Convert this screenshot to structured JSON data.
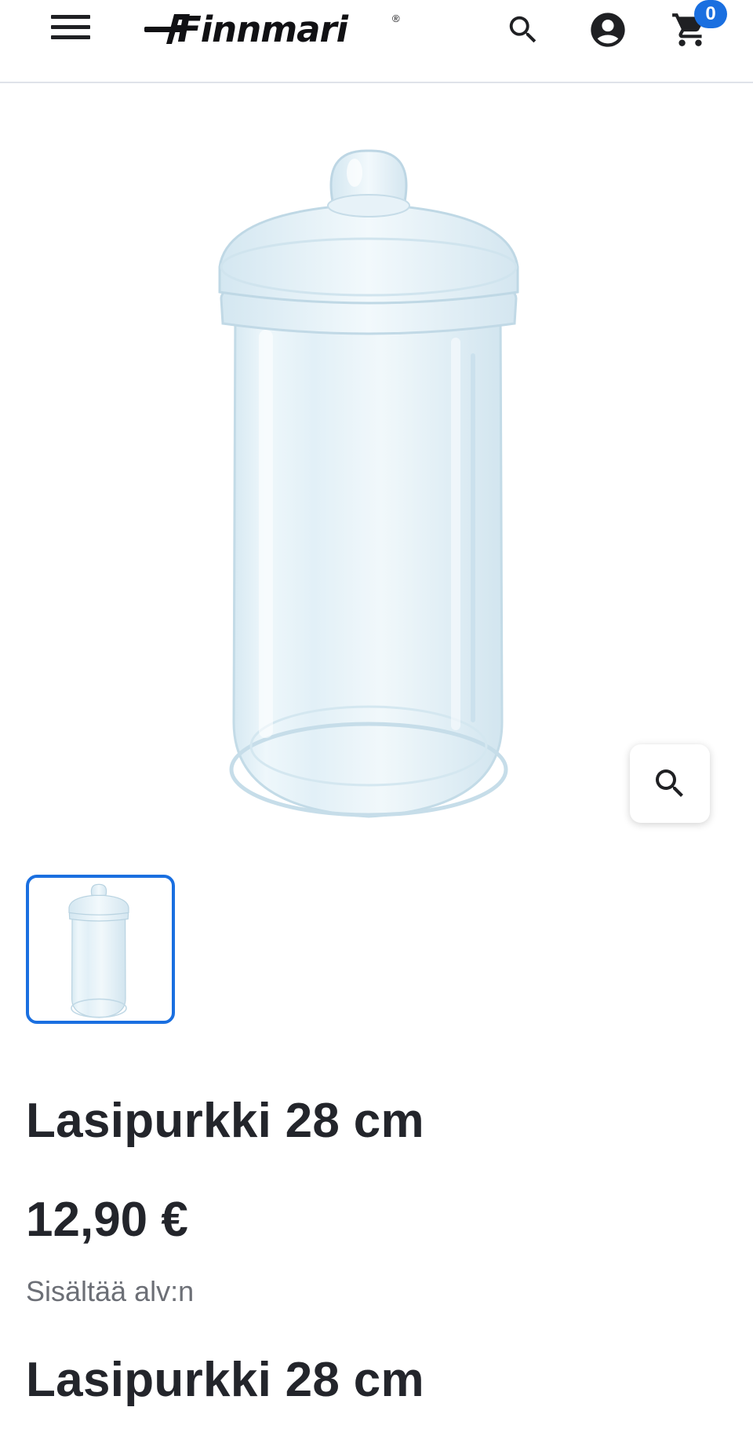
{
  "header": {
    "brand": "Finnmari",
    "registered_mark": "®",
    "cart_count": "0",
    "icons": {
      "menu": "hamburger-menu-icon",
      "search": "search-icon",
      "account": "account-circle-icon",
      "cart": "shopping-cart-icon"
    },
    "accent_color": "#1a6fe0"
  },
  "gallery": {
    "main_image": "glass-jar-with-lid",
    "zoom_icon": "zoom-search-icon",
    "thumbnails": [
      "glass-jar-with-lid"
    ],
    "selected_thumbnail": 0
  },
  "product": {
    "title": "Lasipurkki 28 cm",
    "price": "12,90 €",
    "vat_note": "Sisältää alv:n",
    "title_repeat": "Lasipurkki 28 cm"
  }
}
